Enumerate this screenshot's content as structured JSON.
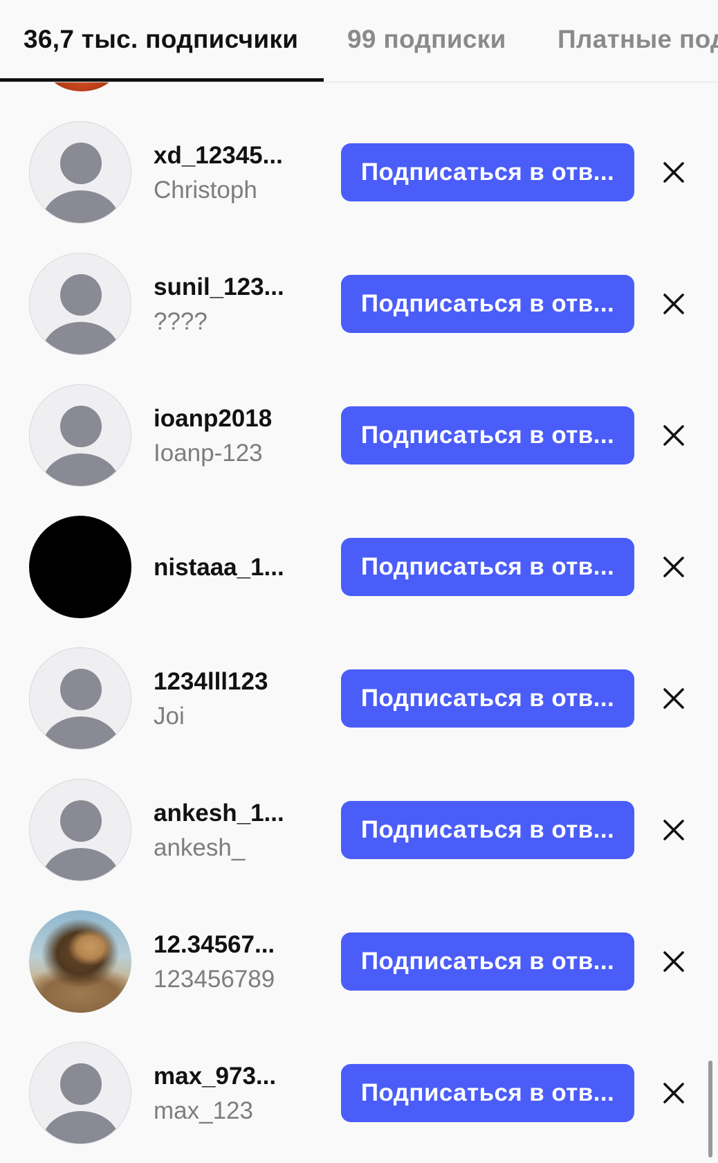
{
  "tabs": [
    {
      "label": "36,7 тыс. подписчики",
      "active": true
    },
    {
      "label": "99 подписки",
      "active": false
    },
    {
      "label": "Платные подписки",
      "active": false
    }
  ],
  "follow_button_label": "Подписаться в отв...",
  "colors": {
    "accent": "#4a5df9",
    "text_primary": "#111111",
    "text_secondary": "#7d7d7d",
    "background": "#f9f9f9"
  },
  "followers": [
    {
      "username": "xd_12345...",
      "full_name": "Christoph",
      "avatar": "default-avatar-icon"
    },
    {
      "username": "sunil_123...",
      "full_name": "????",
      "avatar": "default-avatar-icon"
    },
    {
      "username": "ioanp2018",
      "full_name": "Ioanp-123",
      "avatar": "default-avatar-icon"
    },
    {
      "username": "nistaaa_1...",
      "full_name": "",
      "avatar": "black-photo"
    },
    {
      "username": "1234lll123",
      "full_name": "Joi",
      "avatar": "default-avatar-icon"
    },
    {
      "username": "ankesh_1...",
      "full_name": "ankesh_",
      "avatar": "default-avatar-icon"
    },
    {
      "username": "12.34567...",
      "full_name": "123456789",
      "avatar": "lion-photo"
    },
    {
      "username": "max_973...",
      "full_name": "max_123",
      "avatar": "default-avatar-icon"
    }
  ]
}
